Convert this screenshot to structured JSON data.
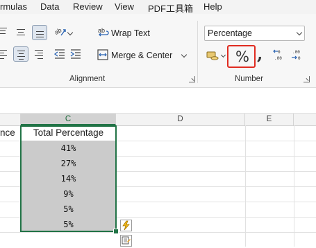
{
  "menu": [
    "rmulas",
    "Data",
    "Review",
    "View",
    "PDF工具箱",
    "Help"
  ],
  "ribbon": {
    "alignment": {
      "wrap_text": "Wrap Text",
      "merge_center": "Merge & Center",
      "group_label": "Alignment"
    },
    "number": {
      "format_value": "Percentage",
      "percent_symbol": "%",
      "comma_symbol": ",",
      "group_label": "Number"
    }
  },
  "sheet": {
    "columns": [
      "C",
      "D",
      "E"
    ],
    "selected_column": "C",
    "partial_cell_text": "nce",
    "header_cell": "Total Percentage",
    "values": [
      "41%",
      "27%",
      "14%",
      "9%",
      "5%",
      "5%"
    ]
  },
  "colors": {
    "selection_green": "#217346",
    "highlight_red": "#e02b20",
    "selected_fill": "#cbcbcb"
  }
}
